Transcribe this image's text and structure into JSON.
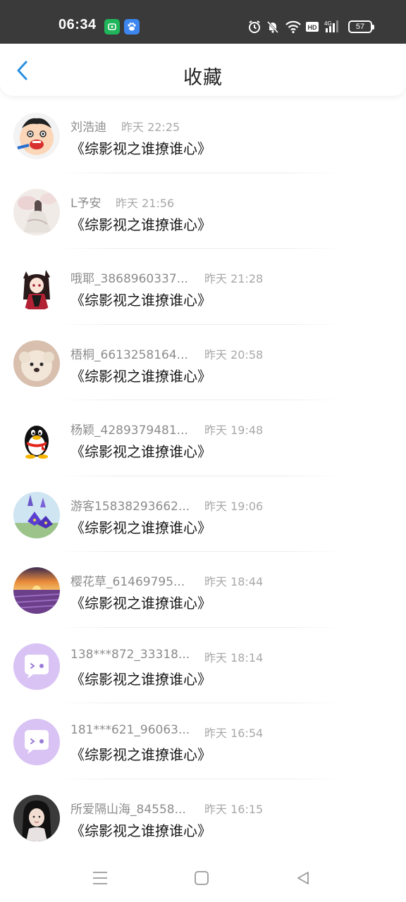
{
  "status_bar": {
    "time": "06:34",
    "battery": "57",
    "icons": [
      "app-green-icon",
      "baidu-paw-icon",
      "alarm-icon",
      "bell-muted-icon",
      "wifi-icon",
      "hd-icon",
      "signal-4g-icon",
      "battery-icon"
    ]
  },
  "header": {
    "title": "收藏",
    "back_icon": "chevron-left-icon",
    "accent": "#2a8fe0"
  },
  "items": [
    {
      "name": "刘浩迪",
      "time": "昨天 22:25",
      "book": "《综影视之谁撩谁心》",
      "avatar": "cartoon-boy"
    },
    {
      "name": "L予安",
      "time": "昨天 21:56",
      "book": "《综影视之谁撩谁心》",
      "avatar": "ink-painting-girl"
    },
    {
      "name": "哦耶_3868960337...",
      "time": "昨天 21:28",
      "book": "《综影视之谁撩谁心》",
      "avatar": "anime-catgirl"
    },
    {
      "name": "梧桐_6613258164...",
      "time": "昨天 20:58",
      "book": "《综影视之谁撩谁心》",
      "avatar": "plush-dog"
    },
    {
      "name": "杨颖_4289379481...",
      "time": "昨天 19:48",
      "book": "《综影视之谁撩谁心》",
      "avatar": "qq-penguin"
    },
    {
      "name": "游客15838293662...",
      "time": "昨天 19:06",
      "book": "《综影视之谁撩谁心》",
      "avatar": "purple-flowers"
    },
    {
      "name": "樱花草_61469795...",
      "time": "昨天 18:44",
      "book": "《综影视之谁撩谁心》",
      "avatar": "lavender-sunset"
    },
    {
      "name": "138***872_33318...",
      "time": "昨天 18:14",
      "book": "《综影视之谁撩谁心》",
      "avatar": "default-chat-purple"
    },
    {
      "name": "181***621_96063...",
      "time": "昨天 16:54",
      "book": "《综影视之谁撩谁心》",
      "avatar": "default-chat-purple"
    },
    {
      "name": "所爱隔山海_84558...",
      "time": "昨天 16:15",
      "book": "《综影视之谁撩谁心》",
      "avatar": "girl-photo"
    }
  ],
  "nav": {
    "icons": [
      "menu-icon",
      "home-square-icon",
      "back-triangle-icon"
    ]
  }
}
